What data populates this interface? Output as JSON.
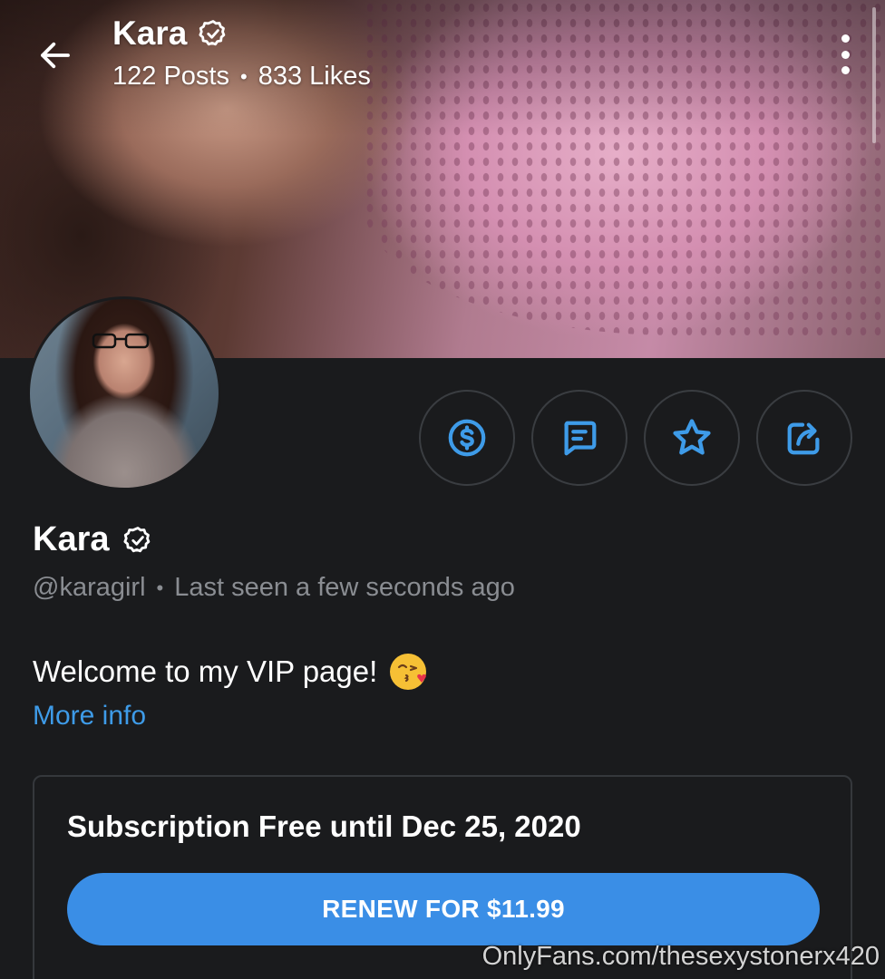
{
  "header": {
    "title": "Kara",
    "posts": "122 Posts",
    "separator": "•",
    "likes": "833 Likes"
  },
  "profile": {
    "name": "Kara",
    "handle": "@karagirl",
    "separator": "•",
    "last_seen": "Last seen a few seconds ago",
    "bio": "Welcome to my VIP page!",
    "bio_emoji": "kissing-face-with-heart-icon",
    "more_info": "More info"
  },
  "actions": [
    {
      "icon": "dollar-tip-icon"
    },
    {
      "icon": "message-icon"
    },
    {
      "icon": "star-favorite-icon"
    },
    {
      "icon": "share-icon"
    }
  ],
  "subscription": {
    "title": "Subscription Free until Dec 25, 2020",
    "button": "RENEW FOR $11.99"
  },
  "watermark": "OnlyFans.com/thesexystonerx420",
  "colors": {
    "background": "#1a1b1d",
    "accent": "#3e9be8",
    "button": "#3a8ee6",
    "muted_text": "#8a8d92"
  }
}
